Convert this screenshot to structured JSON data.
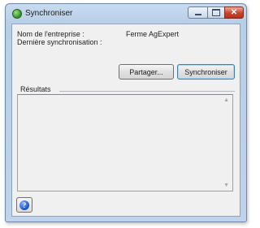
{
  "window": {
    "title": "Synchroniser",
    "icon": "app-sync-icon"
  },
  "info": {
    "company_label": "Nom de l'entreprise :",
    "company_value": "Ferme AgExpert",
    "last_sync_label": "Dernière synchronisation :",
    "last_sync_value": ""
  },
  "buttons": {
    "share": "Partager...",
    "sync": "Synchroniser"
  },
  "results": {
    "label": "Résultats",
    "content": "",
    "scroll_up": "▲",
    "scroll_down": "▼"
  },
  "help": {
    "glyph": "?"
  },
  "caption": {
    "close_glyph": "✕"
  }
}
